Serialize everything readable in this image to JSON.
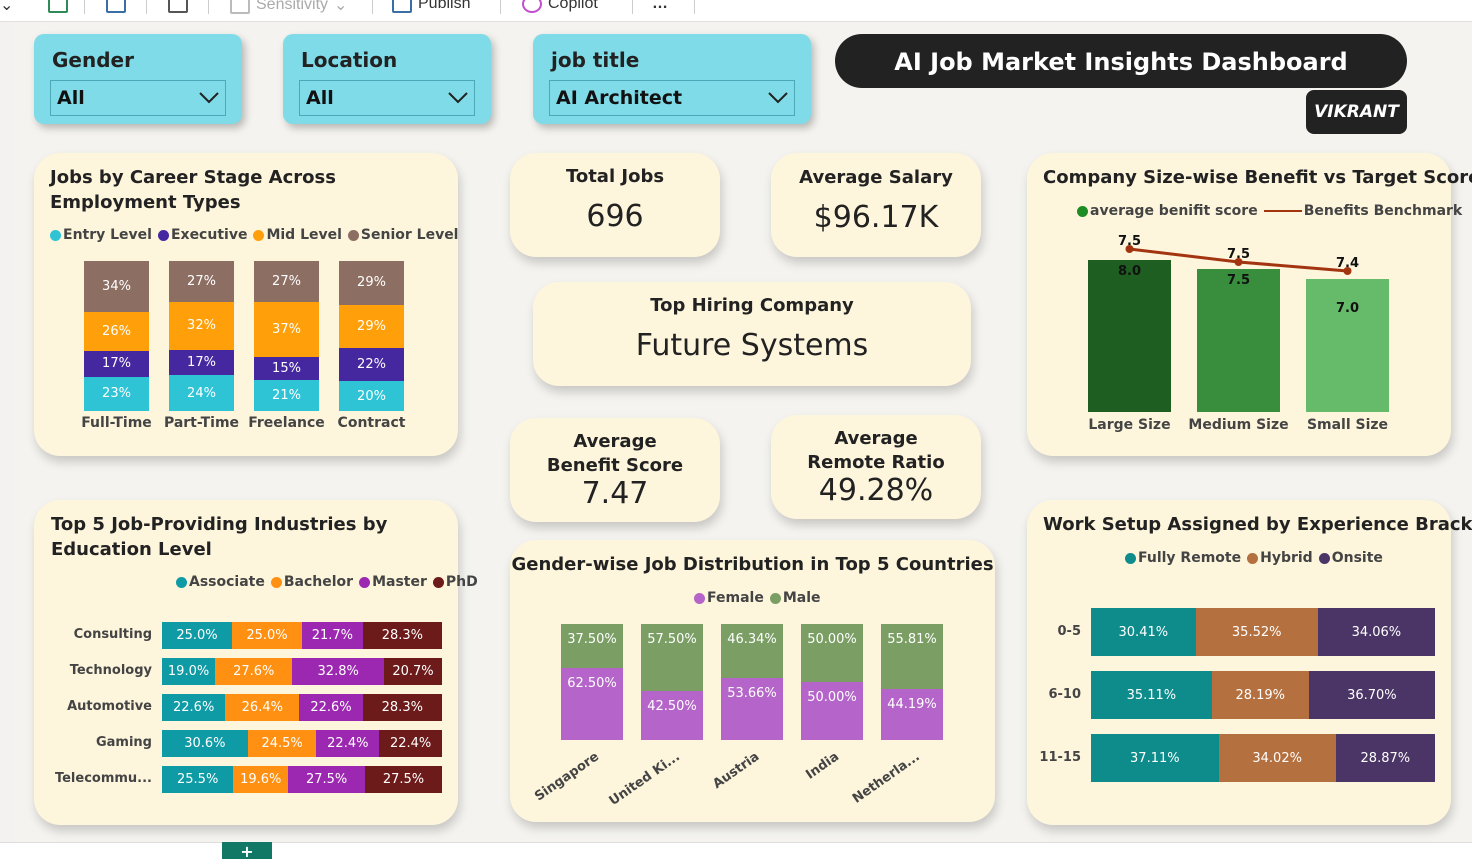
{
  "toolbar": {
    "sensitivity": "Sensitivity",
    "publish": "Publish",
    "copilot": "Copilot",
    "more": "…"
  },
  "slicers": [
    {
      "label": "Gender",
      "value": "All"
    },
    {
      "label": "Location",
      "value": "All"
    },
    {
      "label": "job title",
      "value": "AI Architect"
    }
  ],
  "header": {
    "title": "AI Job Market Insights Dashboard",
    "author": "VIKRANT"
  },
  "kpis": {
    "total_jobs": {
      "label": "Total Jobs",
      "value": "696"
    },
    "avg_salary": {
      "label": "Average Salary",
      "value": "$96.17K"
    },
    "top_company": {
      "label": "Top Hiring Company",
      "value": "Future Systems"
    },
    "avg_benefit": {
      "label": "Average Benefit Score",
      "value": "7.47"
    },
    "avg_remote": {
      "label": "Average Remote Ratio",
      "value": "49.28%"
    }
  },
  "colors": {
    "entry": "#2ec4d6",
    "executive": "#4527a0",
    "mid": "#ff9f0a",
    "senior": "#8d6e63",
    "associate": "#0f9ba5",
    "bachelor": "#ff9012",
    "master": "#9c27b0",
    "phd": "#6d1a1a",
    "female": "#b565c9",
    "male": "#7a9e63",
    "remote": "#0e8c8c",
    "hybrid": "#b5703f",
    "onsite": "#4b3566",
    "large": "#1e5e20",
    "medium": "#388e3c",
    "small": "#66bb6a",
    "benchmark": "#a33410"
  },
  "chart_data": [
    {
      "type": "bar",
      "title": "Jobs by Career Stage Across Employment Types",
      "categories": [
        "Full-Time",
        "Part-Time",
        "Freelance",
        "Contract"
      ],
      "series": [
        {
          "name": "Entry Level",
          "values": [
            23,
            24,
            21,
            20
          ]
        },
        {
          "name": "Executive",
          "values": [
            17,
            17,
            15,
            22
          ]
        },
        {
          "name": "Mid Level",
          "values": [
            26,
            32,
            37,
            29
          ]
        },
        {
          "name": "Senior Level",
          "values": [
            34,
            27,
            27,
            29
          ]
        }
      ],
      "labels": [
        [
          "23%",
          "17%",
          "26%",
          "34%"
        ],
        [
          "24%",
          "17%",
          "32%",
          "27%"
        ],
        [
          "21%",
          "15%",
          "37%",
          "27%"
        ],
        [
          "20%",
          "22%",
          "29%",
          "29%"
        ]
      ],
      "stacked": true,
      "normalized": true,
      "legend": "top-left"
    },
    {
      "type": "bar",
      "title": "Company Size-wise Benefit vs Target Scores\"",
      "categories": [
        "Large Size",
        "Medium Size",
        "Small Size"
      ],
      "series": [
        {
          "name": "average benifit score",
          "values": [
            8.0,
            7.5,
            7.0
          ]
        },
        {
          "name": "Benefits Benchmark",
          "values": [
            7.5,
            7.5,
            7.4
          ],
          "type": "line"
        }
      ],
      "bar_labels": [
        "8.0",
        "7.5",
        "7.0"
      ],
      "line_labels": [
        "7.5",
        "7.5",
        "7.4"
      ],
      "ylim": [
        0,
        8.4
      ],
      "legend": "top-center"
    },
    {
      "type": "bar",
      "orientation": "horizontal",
      "title": "Top 5 Job-Providing Industries by Education Level",
      "categories": [
        "Consulting",
        "Technology",
        "Automotive",
        "Gaming",
        "Telecommu..."
      ],
      "series": [
        {
          "name": "Associate",
          "values": [
            25.0,
            19.0,
            22.6,
            30.6,
            25.5
          ]
        },
        {
          "name": "Bachelor",
          "values": [
            25.0,
            27.6,
            26.4,
            24.5,
            19.6
          ]
        },
        {
          "name": "Master",
          "values": [
            21.7,
            32.8,
            22.6,
            22.4,
            27.5
          ]
        },
        {
          "name": "PhD",
          "values": [
            28.3,
            20.7,
            28.3,
            22.4,
            27.5
          ]
        }
      ],
      "labels": [
        [
          "25.0%",
          "25.0%",
          "21.7%",
          "28.3%"
        ],
        [
          "19.0%",
          "27.6%",
          "32.8%",
          "20.7%"
        ],
        [
          "22.6%",
          "26.4%",
          "22.6%",
          "28.3%"
        ],
        [
          "30.6%",
          "24.5%",
          "22.4%",
          "22.4%"
        ],
        [
          "25.5%",
          "19.6%",
          "27.5%",
          "27.5%"
        ]
      ],
      "stacked": true,
      "normalized": true,
      "legend": "top-right"
    },
    {
      "type": "bar",
      "title": "Gender-wise Job Distribution in Top 5 Countries",
      "categories": [
        "Singapore",
        "United Ki...",
        "Austria",
        "India",
        "Netherla..."
      ],
      "series": [
        {
          "name": "Female",
          "values": [
            62.5,
            42.5,
            53.66,
            50.0,
            44.19
          ]
        },
        {
          "name": "Male",
          "values": [
            37.5,
            57.5,
            46.34,
            50.0,
            55.81
          ]
        }
      ],
      "labels": [
        [
          "62.50%",
          "37.50%"
        ],
        [
          "42.50%",
          "57.50%"
        ],
        [
          "53.66%",
          "46.34%"
        ],
        [
          "50.00%",
          "50.00%"
        ],
        [
          "44.19%",
          "55.81%"
        ]
      ],
      "stacked": true,
      "normalized": true,
      "legend": "top-center"
    },
    {
      "type": "bar",
      "orientation": "horizontal",
      "title": "Work Setup Assigned by Experience Bracket",
      "categories": [
        "0-5",
        "6-10",
        "11-15"
      ],
      "series": [
        {
          "name": "Fully Remote",
          "values": [
            30.41,
            35.11,
            37.11
          ]
        },
        {
          "name": "Hybrid",
          "values": [
            35.52,
            28.19,
            34.02
          ]
        },
        {
          "name": "Onsite",
          "values": [
            34.06,
            36.7,
            28.87
          ]
        }
      ],
      "labels": [
        [
          "30.41%",
          "35.52%",
          "34.06%"
        ],
        [
          "35.11%",
          "28.19%",
          "36.70%"
        ],
        [
          "37.11%",
          "34.02%",
          "28.87%"
        ]
      ],
      "stacked": true,
      "normalized": true,
      "legend": "top-center"
    }
  ]
}
